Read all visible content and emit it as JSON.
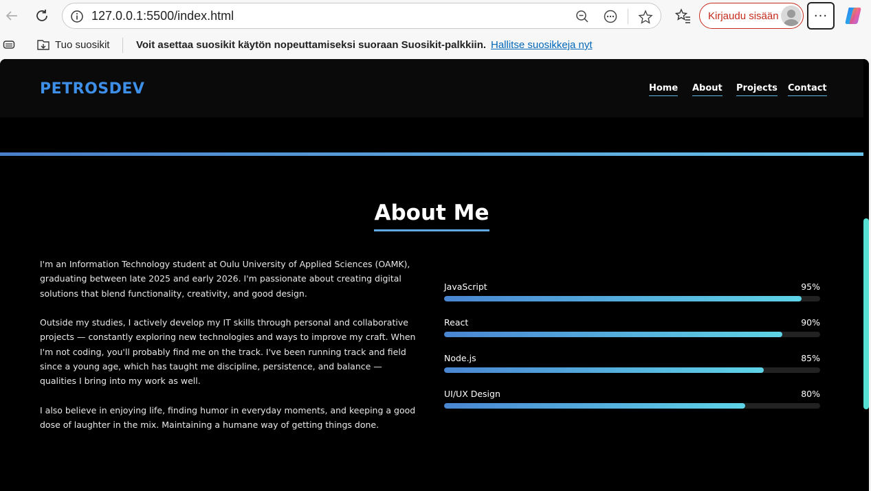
{
  "browser": {
    "url": "127.0.0.1:5500/index.html",
    "signin_label": "Kirjaudu sisään",
    "more_label": "···",
    "icons": [
      "back-icon",
      "refresh-icon",
      "info-icon",
      "zoom-out-icon",
      "reader-icon",
      "star-icon",
      "favorites-icon",
      "profile-icon",
      "copilot-icon"
    ]
  },
  "favbar": {
    "import_label": "Tuo suosikit",
    "message": "Voit asettaa suosikit käytön nopeuttamiseksi suoraan Suosikit-palkkiin.",
    "manage_link": "Hallitse suosikkeja nyt"
  },
  "site": {
    "logo": "PETROSDEV",
    "nav": [
      "Home",
      "About",
      "Projects",
      "Contact"
    ]
  },
  "about": {
    "title": "About Me",
    "paragraphs": [
      "I'm an Information Technology student at Oulu University of Applied Sciences (OAMK), graduating between late 2025 and early 2026. I'm passionate about creating digital solutions that blend functionality, creativity, and good design.",
      "Outside my studies, I actively develop my IT skills through personal and collaborative projects — constantly exploring new technologies and ways to improve my craft. When I'm not coding, you'll probably find me on the track. I've been running track and field since a young age, which has taught me discipline, persistence, and balance — qualities I bring into my work as well.",
      "I also believe in enjoying life, finding humor in everyday moments, and keeping a good dose of laughter in the mix. Maintaining a humane way of getting things done."
    ],
    "skills": [
      {
        "name": "JavaScript",
        "percent_label": "95%",
        "level": 95
      },
      {
        "name": "React",
        "percent_label": "90%",
        "level": 90
      },
      {
        "name": "Node.js",
        "percent_label": "85%",
        "level": 85
      },
      {
        "name": "UI/UX Design",
        "percent_label": "80%",
        "level": 80
      }
    ]
  },
  "colors": {
    "accent_blue": "#3d8fe8",
    "gradient_start": "#4a86d2",
    "gradient_end": "#5ed3e6",
    "signin_red": "#c42b1c",
    "scroll_thumb": "#56e0d3"
  }
}
